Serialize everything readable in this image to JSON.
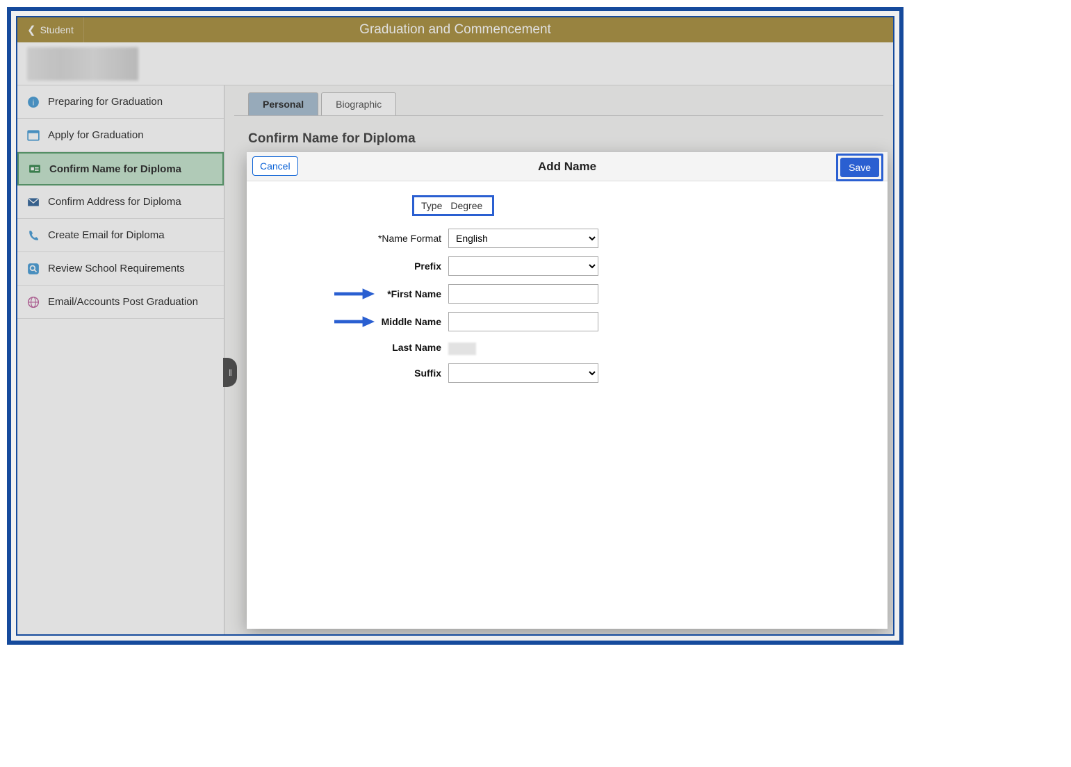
{
  "header": {
    "back_label": "Student",
    "title": "Graduation and Commencement"
  },
  "sidebar": {
    "items": [
      {
        "label": "Preparing for Graduation",
        "icon": "info"
      },
      {
        "label": "Apply for Graduation",
        "icon": "form"
      },
      {
        "label": "Confirm Name for Diploma",
        "icon": "card",
        "active": true
      },
      {
        "label": "Confirm Address for Diploma",
        "icon": "mail"
      },
      {
        "label": "Create Email for Diploma",
        "icon": "phone"
      },
      {
        "label": "Review School Requirements",
        "icon": "search"
      },
      {
        "label": "Email/Accounts Post Graduation",
        "icon": "globe"
      }
    ]
  },
  "main": {
    "tabs": [
      {
        "label": "Personal",
        "active": true
      },
      {
        "label": "Biographic",
        "active": false
      }
    ],
    "section_heading": "Confirm Name for Diploma"
  },
  "modal": {
    "cancel_label": "Cancel",
    "title": "Add Name",
    "save_label": "Save",
    "type_label": "Type",
    "type_value": "Degree",
    "fields": {
      "name_format": {
        "label": "*Name Format",
        "value": "English"
      },
      "prefix": {
        "label": "Prefix",
        "value": ""
      },
      "first_name": {
        "label": "*First Name",
        "value": ""
      },
      "middle_name": {
        "label": "Middle Name",
        "value": ""
      },
      "last_name": {
        "label": "Last Name",
        "value": ""
      },
      "suffix": {
        "label": "Suffix",
        "value": ""
      }
    }
  },
  "colors": {
    "accent": "#2a5fd1",
    "topbar": "#b09540",
    "sidebar_active": "#c5e6cf"
  }
}
